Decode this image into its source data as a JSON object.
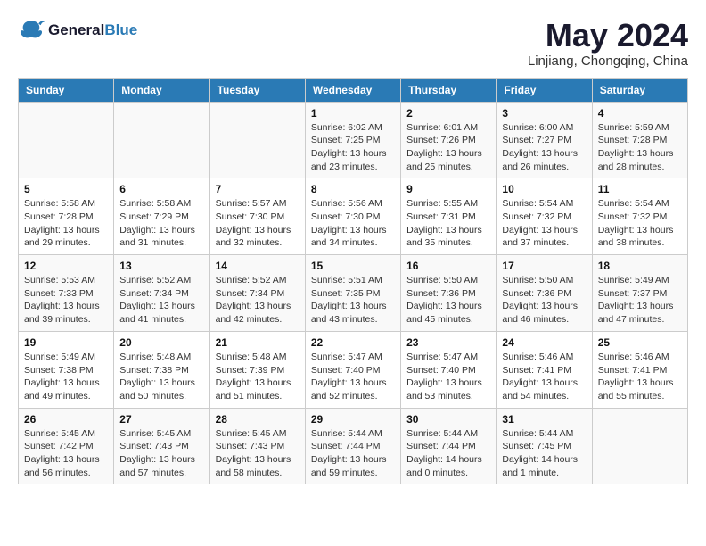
{
  "logo": {
    "text_general": "General",
    "text_blue": "Blue"
  },
  "header": {
    "month_year": "May 2024",
    "location": "Linjiang, Chongqing, China"
  },
  "weekdays": [
    "Sunday",
    "Monday",
    "Tuesday",
    "Wednesday",
    "Thursday",
    "Friday",
    "Saturday"
  ],
  "weeks": [
    {
      "days": [
        {
          "date": "",
          "info": ""
        },
        {
          "date": "",
          "info": ""
        },
        {
          "date": "",
          "info": ""
        },
        {
          "date": "1",
          "info": "Sunrise: 6:02 AM\nSunset: 7:25 PM\nDaylight: 13 hours\nand 23 minutes."
        },
        {
          "date": "2",
          "info": "Sunrise: 6:01 AM\nSunset: 7:26 PM\nDaylight: 13 hours\nand 25 minutes."
        },
        {
          "date": "3",
          "info": "Sunrise: 6:00 AM\nSunset: 7:27 PM\nDaylight: 13 hours\nand 26 minutes."
        },
        {
          "date": "4",
          "info": "Sunrise: 5:59 AM\nSunset: 7:28 PM\nDaylight: 13 hours\nand 28 minutes."
        }
      ]
    },
    {
      "days": [
        {
          "date": "5",
          "info": "Sunrise: 5:58 AM\nSunset: 7:28 PM\nDaylight: 13 hours\nand 29 minutes."
        },
        {
          "date": "6",
          "info": "Sunrise: 5:58 AM\nSunset: 7:29 PM\nDaylight: 13 hours\nand 31 minutes."
        },
        {
          "date": "7",
          "info": "Sunrise: 5:57 AM\nSunset: 7:30 PM\nDaylight: 13 hours\nand 32 minutes."
        },
        {
          "date": "8",
          "info": "Sunrise: 5:56 AM\nSunset: 7:30 PM\nDaylight: 13 hours\nand 34 minutes."
        },
        {
          "date": "9",
          "info": "Sunrise: 5:55 AM\nSunset: 7:31 PM\nDaylight: 13 hours\nand 35 minutes."
        },
        {
          "date": "10",
          "info": "Sunrise: 5:54 AM\nSunset: 7:32 PM\nDaylight: 13 hours\nand 37 minutes."
        },
        {
          "date": "11",
          "info": "Sunrise: 5:54 AM\nSunset: 7:32 PM\nDaylight: 13 hours\nand 38 minutes."
        }
      ]
    },
    {
      "days": [
        {
          "date": "12",
          "info": "Sunrise: 5:53 AM\nSunset: 7:33 PM\nDaylight: 13 hours\nand 39 minutes."
        },
        {
          "date": "13",
          "info": "Sunrise: 5:52 AM\nSunset: 7:34 PM\nDaylight: 13 hours\nand 41 minutes."
        },
        {
          "date": "14",
          "info": "Sunrise: 5:52 AM\nSunset: 7:34 PM\nDaylight: 13 hours\nand 42 minutes."
        },
        {
          "date": "15",
          "info": "Sunrise: 5:51 AM\nSunset: 7:35 PM\nDaylight: 13 hours\nand 43 minutes."
        },
        {
          "date": "16",
          "info": "Sunrise: 5:50 AM\nSunset: 7:36 PM\nDaylight: 13 hours\nand 45 minutes."
        },
        {
          "date": "17",
          "info": "Sunrise: 5:50 AM\nSunset: 7:36 PM\nDaylight: 13 hours\nand 46 minutes."
        },
        {
          "date": "18",
          "info": "Sunrise: 5:49 AM\nSunset: 7:37 PM\nDaylight: 13 hours\nand 47 minutes."
        }
      ]
    },
    {
      "days": [
        {
          "date": "19",
          "info": "Sunrise: 5:49 AM\nSunset: 7:38 PM\nDaylight: 13 hours\nand 49 minutes."
        },
        {
          "date": "20",
          "info": "Sunrise: 5:48 AM\nSunset: 7:38 PM\nDaylight: 13 hours\nand 50 minutes."
        },
        {
          "date": "21",
          "info": "Sunrise: 5:48 AM\nSunset: 7:39 PM\nDaylight: 13 hours\nand 51 minutes."
        },
        {
          "date": "22",
          "info": "Sunrise: 5:47 AM\nSunset: 7:40 PM\nDaylight: 13 hours\nand 52 minutes."
        },
        {
          "date": "23",
          "info": "Sunrise: 5:47 AM\nSunset: 7:40 PM\nDaylight: 13 hours\nand 53 minutes."
        },
        {
          "date": "24",
          "info": "Sunrise: 5:46 AM\nSunset: 7:41 PM\nDaylight: 13 hours\nand 54 minutes."
        },
        {
          "date": "25",
          "info": "Sunrise: 5:46 AM\nSunset: 7:41 PM\nDaylight: 13 hours\nand 55 minutes."
        }
      ]
    },
    {
      "days": [
        {
          "date": "26",
          "info": "Sunrise: 5:45 AM\nSunset: 7:42 PM\nDaylight: 13 hours\nand 56 minutes."
        },
        {
          "date": "27",
          "info": "Sunrise: 5:45 AM\nSunset: 7:43 PM\nDaylight: 13 hours\nand 57 minutes."
        },
        {
          "date": "28",
          "info": "Sunrise: 5:45 AM\nSunset: 7:43 PM\nDaylight: 13 hours\nand 58 minutes."
        },
        {
          "date": "29",
          "info": "Sunrise: 5:44 AM\nSunset: 7:44 PM\nDaylight: 13 hours\nand 59 minutes."
        },
        {
          "date": "30",
          "info": "Sunrise: 5:44 AM\nSunset: 7:44 PM\nDaylight: 14 hours\nand 0 minutes."
        },
        {
          "date": "31",
          "info": "Sunrise: 5:44 AM\nSunset: 7:45 PM\nDaylight: 14 hours\nand 1 minute."
        },
        {
          "date": "",
          "info": ""
        }
      ]
    }
  ]
}
